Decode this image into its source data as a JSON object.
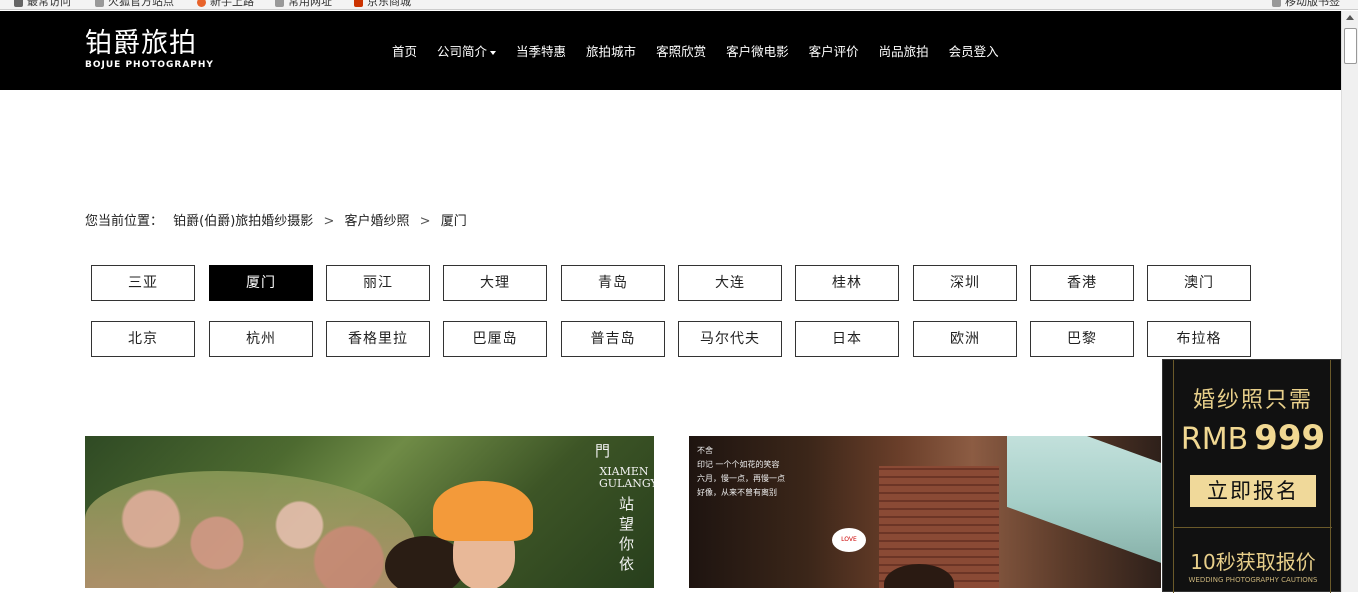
{
  "bookmarks": [
    {
      "label": "最常访问",
      "color": "#666"
    },
    {
      "label": "火狐官方站点",
      "color": "#999"
    },
    {
      "label": "新手上路",
      "color": "#e8632b"
    },
    {
      "label": "常用网址",
      "color": "#999"
    },
    {
      "label": "京东商城",
      "color": "#c30"
    },
    {
      "label": "移动版书签",
      "color": "#999"
    }
  ],
  "header": {
    "logo_cn": "铂爵旅拍",
    "logo_en": "BOJUE PHOTOGRAPHY",
    "nav": [
      "首页",
      "公司简介",
      "当季特惠",
      "旅拍城市",
      "客照欣赏",
      "客户微电影",
      "客户评价",
      "尚品旅拍",
      "会员登入"
    ],
    "bg_color": "#000000"
  },
  "breadcrumb": {
    "prefix": "您当前位置：",
    "items": [
      "铂爵(伯爵)旅拍婚纱摄影",
      "客户婚纱照",
      "厦门"
    ],
    "separator": ">"
  },
  "cities": {
    "row1": [
      "三亚",
      "厦门",
      "丽江",
      "大理",
      "青岛",
      "大连",
      "桂林",
      "深圳",
      "香港",
      "澳门"
    ],
    "row2": [
      "北京",
      "杭州",
      "香格里拉",
      "巴厘岛",
      "普吉岛",
      "马尔代夫",
      "日本",
      "欧洲",
      "巴黎",
      "布拉格"
    ],
    "active": "厦门"
  },
  "photos": {
    "photo1": {
      "cap1": "門",
      "cap2": "XIAMEN GULANGYU",
      "cap3": "站 望 你 依"
    },
    "photo2": {
      "lines": [
        "不舍",
        "印记  一个个如花的笑容",
        "六月，慢一点，再慢一点",
        "好像，从来不曾有离别"
      ],
      "bubble": "LOVE"
    }
  },
  "promo": {
    "line1": "婚纱照只需",
    "rmb": "RMB",
    "price": "999",
    "button": "立即报名",
    "line3": "10秒获取报价",
    "line4": "WEDDING PHOTOGRAPHY CAUTIONS",
    "accent": "#f0d99a"
  }
}
